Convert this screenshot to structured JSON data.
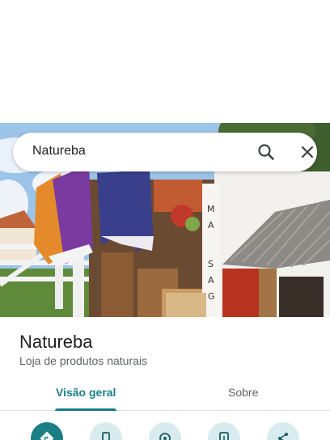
{
  "search": {
    "query": "Natureba"
  },
  "place": {
    "name": "Natureba",
    "category": "Loja de produtos naturais"
  },
  "tabs": [
    {
      "label": "Visão geral",
      "active": true
    },
    {
      "label": "Sobre",
      "active": false
    }
  ],
  "actions": [
    {
      "icon": "directions-icon"
    },
    {
      "icon": "phone-icon"
    },
    {
      "icon": "save-icon"
    },
    {
      "icon": "send-to-phone-icon"
    },
    {
      "icon": "share-icon"
    }
  ],
  "colors": {
    "accent": "#1a7f85",
    "action_bg": "#d8ecef"
  }
}
